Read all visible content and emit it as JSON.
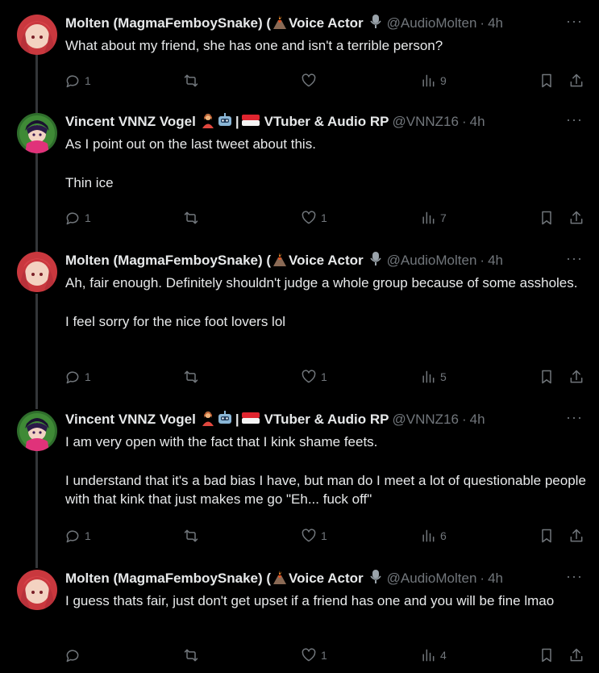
{
  "tweets": [
    {
      "name": "Molten (MagmaFemboySnake) (",
      "name_suffix": "Voice Actor",
      "handle": "@AudioMolten",
      "time": "4h",
      "text": [
        "What about my friend, she has one and isn't a terrible person?"
      ],
      "replies": "1",
      "retweets": "",
      "likes": "",
      "views": "9"
    },
    {
      "name": "Vincent VNNZ Vogel",
      "name_suffix": "VTuber & Audio RP",
      "handle": "@VNNZ16",
      "time": "4h",
      "text": [
        "As I point out on the last tweet about this.",
        "Thin ice"
      ],
      "replies": "1",
      "retweets": "",
      "likes": "1",
      "views": "7"
    },
    {
      "name": "Molten (MagmaFemboySnake) (",
      "name_suffix": "Voice Actor",
      "handle": "@AudioMolten",
      "time": "4h",
      "text": [
        "Ah, fair enough. Definitely shouldn't judge a whole group because of some assholes.",
        "I feel sorry for the nice foot lovers lol"
      ],
      "replies": "1",
      "retweets": "",
      "likes": "1",
      "views": "5"
    },
    {
      "name": "Vincent VNNZ Vogel",
      "name_suffix": "VTuber & Audio RP",
      "handle": "@VNNZ16",
      "time": "4h",
      "text": [
        "I am very open with the fact that I kink shame feets.",
        "I understand that it's a bad bias I have, but man do I meet a lot of questionable people with that kink that just makes me go \"Eh... fuck off\""
      ],
      "replies": "1",
      "retweets": "",
      "likes": "1",
      "views": "6"
    },
    {
      "name": "Molten (MagmaFemboySnake) (",
      "name_suffix": "Voice Actor",
      "handle": "@AudioMolten",
      "time": "4h",
      "text": [
        "I guess thats fair, just don't get upset if a friend has one and you will be fine lmao"
      ],
      "replies": "",
      "retweets": "",
      "likes": "1",
      "views": "4"
    }
  ],
  "ui": {
    "more_glyph": "···",
    "separator": "·"
  },
  "icons": [
    "reply-icon",
    "retweet-icon",
    "like-icon",
    "views-icon",
    "bookmark-icon",
    "share-icon",
    "more-icon",
    "volcano-emoji",
    "microphone-emoji",
    "person-emoji",
    "robot-emoji",
    "flag-emoji"
  ],
  "colors": {
    "background": "#000000",
    "text": "#e7e9ea",
    "muted": "#71767b",
    "connector": "#333639"
  }
}
